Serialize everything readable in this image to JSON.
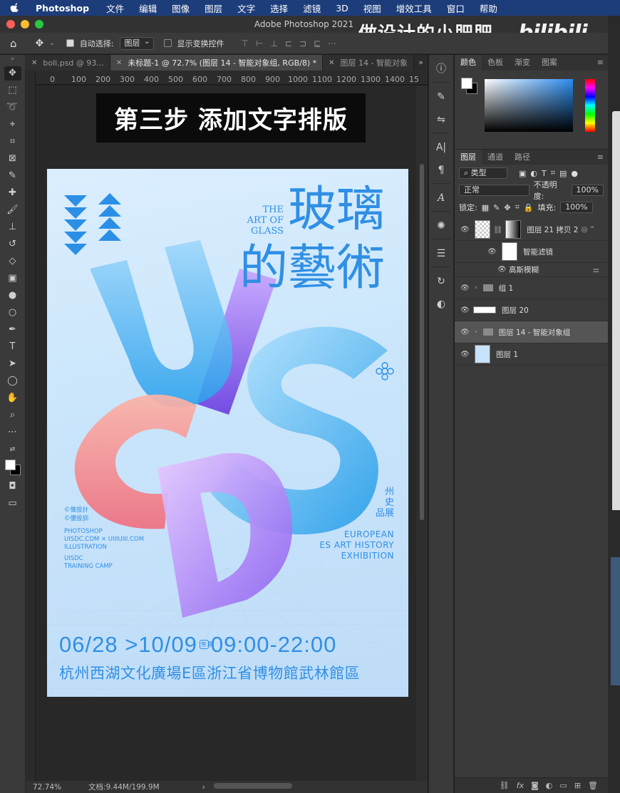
{
  "menubar": {
    "app": "Photoshop",
    "items": [
      "文件",
      "编辑",
      "图像",
      "图层",
      "文字",
      "选择",
      "滤镜",
      "3D",
      "视图",
      "增效工具",
      "窗口",
      "帮助"
    ]
  },
  "window": {
    "title": "Adobe Photoshop 2021"
  },
  "watermark": {
    "text": "做设计的小肥肥",
    "logo": "bilibili"
  },
  "options": {
    "auto_select_label": "自动选择:",
    "auto_select_value": "图层",
    "show_transform_label": "显示变换控件"
  },
  "tabs": [
    {
      "label": "boli.psd @ 93..."
    },
    {
      "label": "未标题-1 @ 72.7% (图层 14 - 智能对象组, RGB/8) *"
    },
    {
      "label": "图层 14 - 智能对象"
    }
  ],
  "ruler": {
    "ticks": [
      "0",
      "100",
      "200",
      "300",
      "400",
      "500",
      "600",
      "700",
      "800",
      "900",
      "1000",
      "1100",
      "1200",
      "1300",
      "1400",
      "15"
    ]
  },
  "banner": {
    "text": "第三步 添加文字排版"
  },
  "poster": {
    "title_line1": "玻璃",
    "title_line2": "的藝術",
    "en_title": [
      "THE",
      "ART OF",
      "GLASS"
    ],
    "left_small": [
      "©做設計",
      "©優設訓"
    ],
    "left_block": [
      "PHOTOSHOP",
      "UISDC.COM × UIIIUIII.COM",
      "ILLUSTRATION"
    ],
    "left_block2": [
      "UISDC",
      "TRAINING CAMP"
    ],
    "right_cn": [
      "州",
      "史",
      "品展"
    ],
    "right_en": [
      "EUROPEAN",
      "ES ART HISTORY",
      "EXHIBITION"
    ],
    "date_from": "06/28",
    "date_to": ">10/09",
    "badge": "免票",
    "time": "09:00-22:00",
    "venue": "杭州西湖文化廣場E區浙江省博物館武林館區",
    "letters": [
      "U",
      "I",
      "S",
      "C",
      "D"
    ]
  },
  "status": {
    "zoom": "72.74%",
    "doc": "文档:9.44M/199.9M",
    "arrow": "›"
  },
  "panels": {
    "color_tabs": [
      "颜色",
      "色板",
      "渐变",
      "图案"
    ],
    "layer_tabs": [
      "图层",
      "通道",
      "路径"
    ],
    "filter_kind": "类型",
    "blend_mode": "正常",
    "opacity_label": "不透明度:",
    "opacity_value": "100%",
    "lock_label": "锁定:",
    "fill_label": "填充:",
    "fill_value": "100%",
    "layers": [
      {
        "name": "图层 21 拷贝 2",
        "kind": "smart"
      },
      {
        "name": "智能滤镜",
        "kind": "filter"
      },
      {
        "name": "高斯模糊",
        "kind": "sub"
      },
      {
        "name": "组 1",
        "kind": "group"
      },
      {
        "name": "图层 20",
        "kind": "layer"
      },
      {
        "name": "图层 14 - 智能对象组",
        "kind": "group",
        "selected": true
      },
      {
        "name": "图层 1",
        "kind": "layer"
      }
    ]
  },
  "colors": {
    "menubar": "#1d3d7a",
    "poster_text": "#2f8fe4",
    "accent_blue": "#3aa6ef",
    "accent_pink": "#f07b86",
    "accent_purple": "#9a6cf0"
  }
}
